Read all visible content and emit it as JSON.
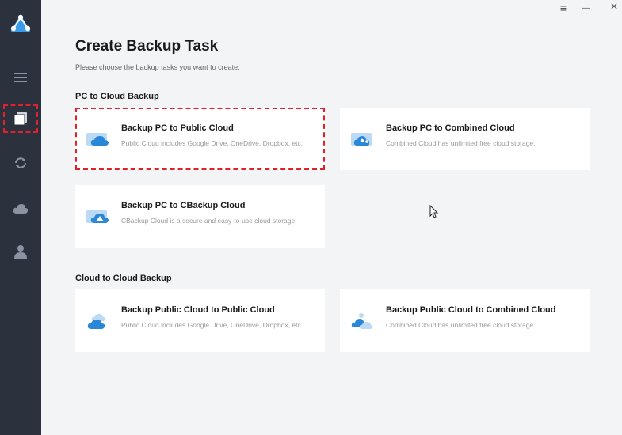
{
  "sidebar": {
    "items": [
      {
        "name": "logo"
      },
      {
        "name": "menu-list-icon"
      },
      {
        "name": "backup-tasks-icon",
        "active": true
      },
      {
        "name": "sync-icon"
      },
      {
        "name": "cloud-icon"
      },
      {
        "name": "user-icon"
      }
    ]
  },
  "window": {
    "menu": "≡",
    "minimize": "—",
    "close": "×"
  },
  "page": {
    "title": "Create Backup Task",
    "subtitle": "Please choose the backup tasks you want to create."
  },
  "sections": {
    "pc_to_cloud": "PC to Cloud Backup",
    "cloud_to_cloud": "Cloud to Cloud Backup"
  },
  "cards": {
    "pc_public": {
      "title": "Backup PC to Public Cloud",
      "desc": "Public Cloud includes Google Drive, OneDrive, Dropbox, etc."
    },
    "pc_combined": {
      "title": "Backup PC to Combined Cloud",
      "desc": "Combined Cloud has unlimited free cloud storage."
    },
    "pc_cbackup": {
      "title": "Backup PC to CBackup Cloud",
      "desc": "CBackup Cloud is a secure and easy-to-use cloud storage."
    },
    "cloud_public": {
      "title": "Backup Public Cloud to Public Cloud",
      "desc": "Public Cloud includes Google Drive, OneDrive, Dropbox, etc."
    },
    "cloud_combined": {
      "title": "Backup Public Cloud to Combined Cloud",
      "desc": "Combined Cloud has unlimited free cloud storage."
    }
  },
  "colors": {
    "accent": "#2a87d8",
    "sidebar": "#2b313d",
    "highlight": "#e0202a"
  }
}
